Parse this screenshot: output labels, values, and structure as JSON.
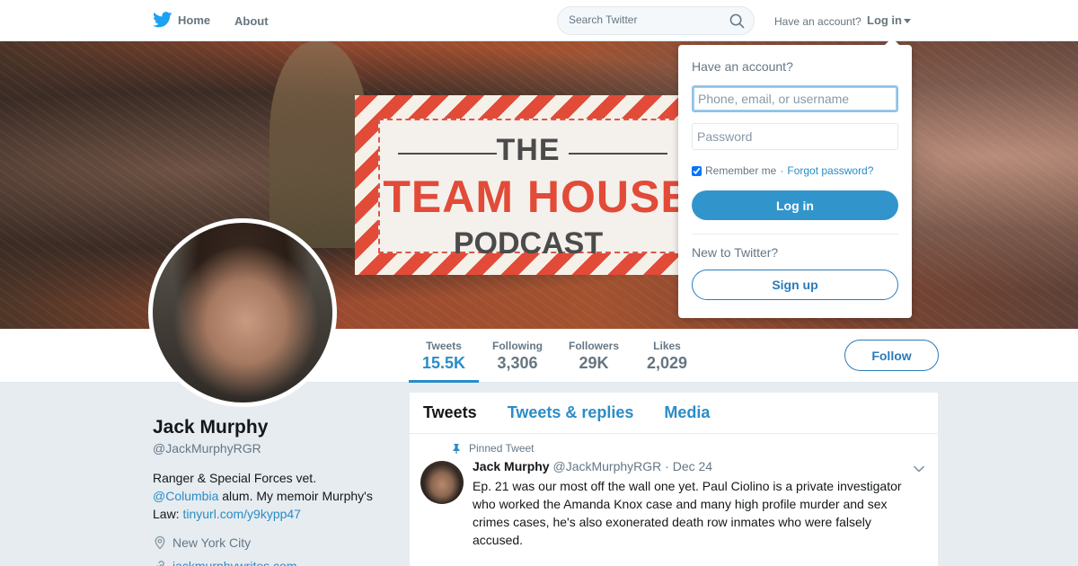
{
  "nav": {
    "home_label": "Home",
    "about_label": "About",
    "search_placeholder": "Search Twitter",
    "have_account": "Have an account?",
    "login_label": "Log in"
  },
  "banner": {
    "line1": "THE",
    "line2": "TEAM HOUSE",
    "line3": "PODCAST"
  },
  "stats": [
    {
      "label": "Tweets",
      "value": "15.5K"
    },
    {
      "label": "Following",
      "value": "3,306"
    },
    {
      "label": "Followers",
      "value": "29K"
    },
    {
      "label": "Likes",
      "value": "2,029"
    }
  ],
  "follow_label": "Follow",
  "profile": {
    "name": "Jack Murphy",
    "handle": "@JackMurphyRGR",
    "bio_line1": "Ranger & Special Forces vet.",
    "bio_mention": "@Columbia",
    "bio_mid": " alum. My memoir Murphy's Law: ",
    "bio_link": "tinyurl.com/y9kypp47",
    "location": "New York City",
    "website": "jackmurphywrites.com"
  },
  "timeline": {
    "tabs": [
      "Tweets",
      "Tweets & replies",
      "Media"
    ],
    "pinned_label": "Pinned Tweet",
    "tweet": {
      "name": "Jack Murphy",
      "handle": "@JackMurphyRGR",
      "date": "· Dec 24",
      "text": "Ep. 21 was our most off the wall one yet. Paul Ciolino is a private investigator who worked the Amanda Knox case and many high profile murder and sex crimes cases, he's also exonerated death row inmates who were falsely accused."
    }
  },
  "login_panel": {
    "title": "Have an account?",
    "username_placeholder": "Phone, email, or username",
    "password_placeholder": "Password",
    "remember": "Remember me",
    "separator": "·",
    "forgot": "Forgot password?",
    "login_button": "Log in",
    "new_label": "New to Twitter?",
    "signup_button": "Sign up"
  },
  "colors": {
    "accent": "#2b8cc7",
    "twitter_blue": "#1da1f2",
    "text_muted": "#657786"
  },
  "icons": {
    "logo": "twitter-bird-icon",
    "search": "search-icon",
    "pin": "pin-icon",
    "location": "location-pin-icon",
    "link": "link-icon",
    "caret": "chevron-down-icon"
  }
}
